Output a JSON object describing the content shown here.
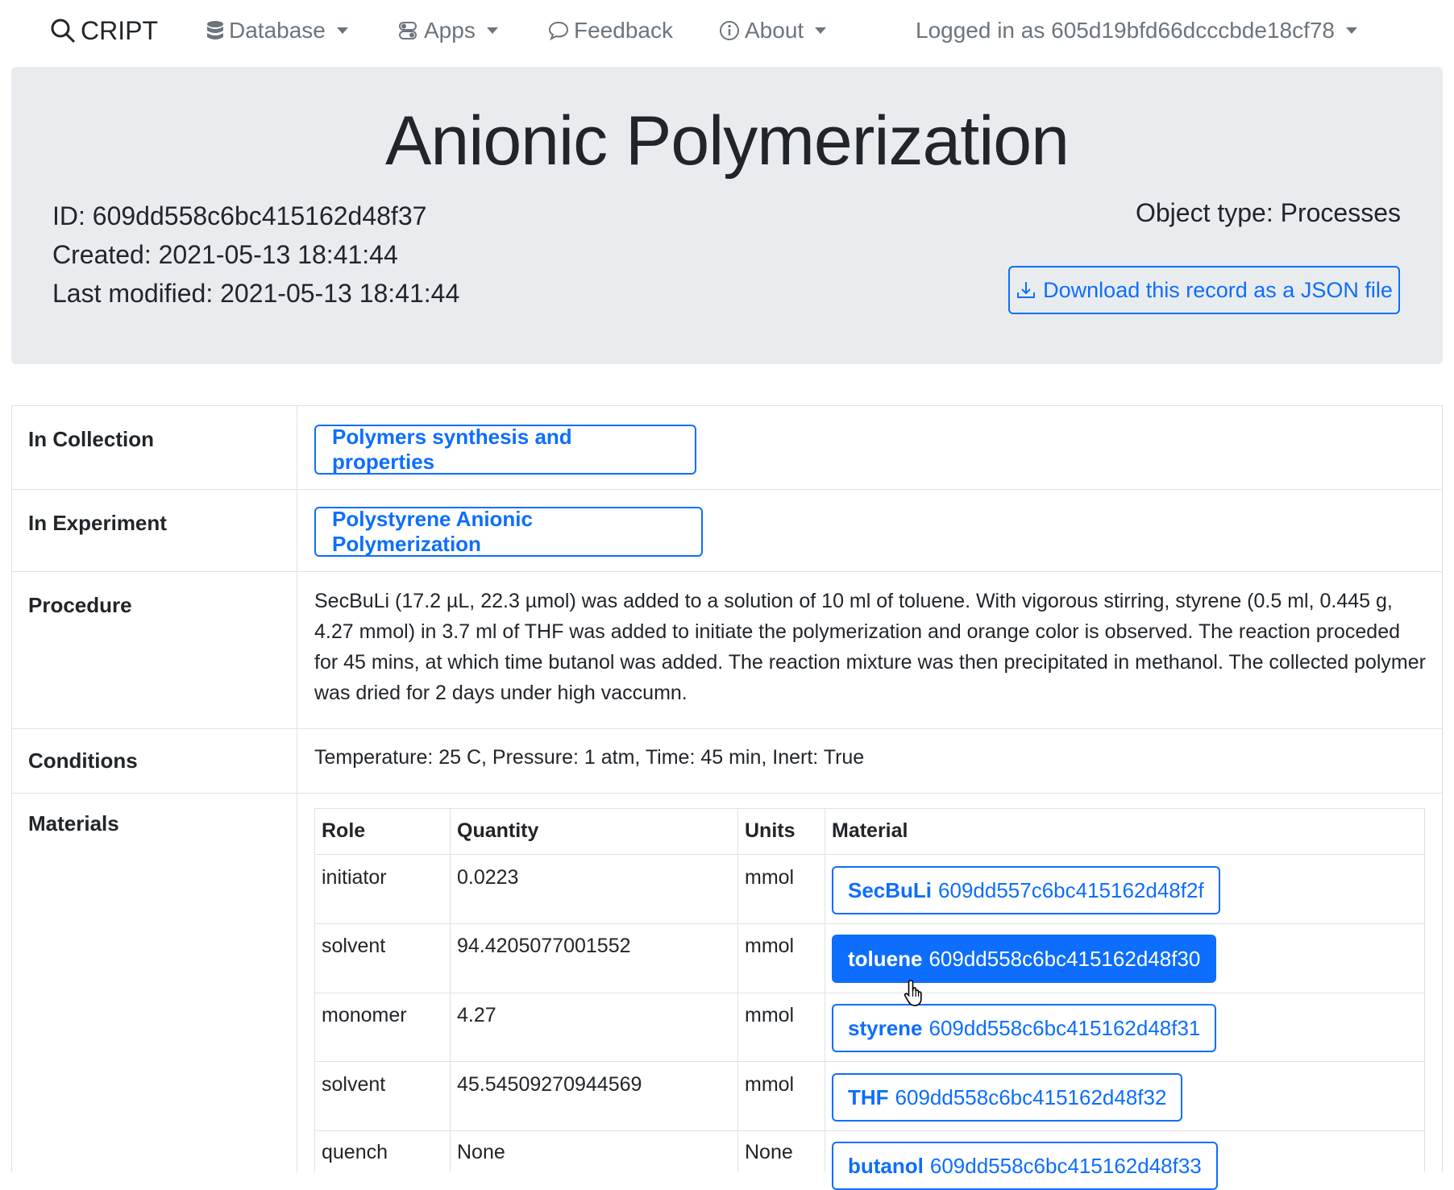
{
  "navbar": {
    "brand": "CRIPT",
    "database": "Database",
    "apps": "Apps",
    "feedback": "Feedback",
    "about": "About",
    "user": "Logged in as 605d19bfd66dcccbde18cf78"
  },
  "header": {
    "title": "Anionic Polymerization",
    "id_label": "ID:",
    "id_value": "609dd558c6bc415162d48f37",
    "created_label": "Created:",
    "created_value": "2021-05-13 18:41:44",
    "modified_label": "Last modified:",
    "modified_value": "2021-05-13 18:41:44",
    "object_type_label": "Object type:",
    "object_type_value": "Processes",
    "download_label": "Download this record as a JSON file"
  },
  "details": {
    "collection_label": "In Collection",
    "collection_value": "Polymers synthesis and properties",
    "experiment_label": "In Experiment",
    "experiment_value": "Polystyrene Anionic Polymerization",
    "procedure_label": "Procedure",
    "procedure_value": "SecBuLi (17.2 µL, 22.3 µmol) was added to a solution of 10 ml of toluene. With vigorous stirring, styrene (0.5 ml, 0.445 g, 4.27 mmol) in 3.7 ml of THF was added to initiate the polymerization and orange color is observed. The reaction proceded for 45 mins, at which time butanol was added. The reaction mixture was then precipitated in methanol. The collected polymer was dried for 2 days under high vaccumn.",
    "conditions_label": "Conditions",
    "conditions_value": "Temperature: 25 C, Pressure: 1 atm, Time: 45 min, Inert: True",
    "materials_label": "Materials"
  },
  "materials": {
    "headers": [
      "Role",
      "Quantity",
      "Units",
      "Material"
    ],
    "rows": [
      {
        "role": "initiator",
        "quantity": "0.0223",
        "units": "mmol",
        "name": "SecBuLi",
        "id": "609dd557c6bc415162d48f2f"
      },
      {
        "role": "solvent",
        "quantity": "94.4205077001552",
        "units": "mmol",
        "name": "toluene",
        "id": "609dd558c6bc415162d48f30"
      },
      {
        "role": "monomer",
        "quantity": "4.27",
        "units": "mmol",
        "name": "styrene",
        "id": "609dd558c6bc415162d48f31"
      },
      {
        "role": "solvent",
        "quantity": "45.54509270944569",
        "units": "mmol",
        "name": "THF",
        "id": "609dd558c6bc415162d48f32"
      },
      {
        "role": "quench",
        "quantity": "None",
        "units": "None",
        "name": "butanol",
        "id": "609dd558c6bc415162d48f33"
      }
    ]
  },
  "colors": {
    "primary": "#0d6efd",
    "jumbotron_bg": "#e9ecef",
    "border": "#dee2e6",
    "muted": "#6c757d"
  },
  "icons": [
    "search-icon",
    "database-icon",
    "apps-icon",
    "chat-icon",
    "info-icon",
    "download-icon",
    "hand-cursor-icon"
  ]
}
